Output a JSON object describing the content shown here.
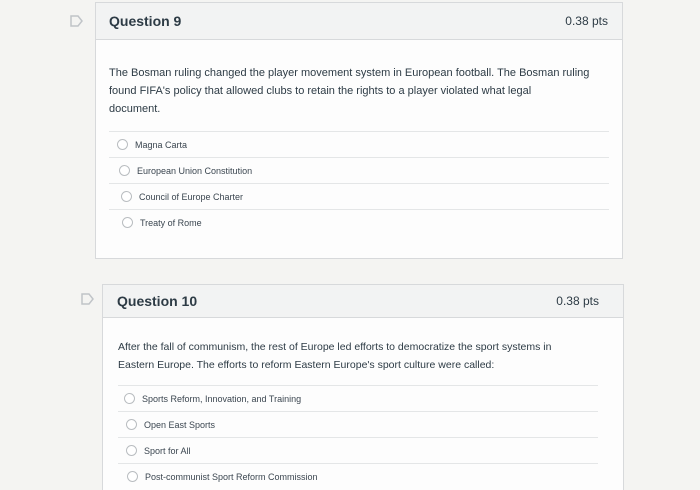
{
  "questions": [
    {
      "title": "Question 9",
      "points": "0.38 pts",
      "text_lines": [
        "The Bosman ruling changed the player movement system in European football. The Bosman ruling",
        "found FIFA's policy that allowed clubs to retain the rights to a player violated what legal",
        "document."
      ],
      "answers": [
        "Magna Carta",
        "European Union Constitution",
        "Council of Europe Charter",
        "Treaty of Rome"
      ]
    },
    {
      "title": "Question 10",
      "points": "0.38 pts",
      "text_lines": [
        "After the fall of communism, the rest of Europe led efforts to democratize the sport systems in",
        "Eastern Europe. The efforts to reform Eastern Europe's sport culture were called:"
      ],
      "answers": [
        "Sports Reform, Innovation, and Training",
        "Open East Sports",
        "Sport for All",
        "Post-communist Sport Reform Commission"
      ]
    }
  ],
  "icons": {
    "flag": "flag-question-icon"
  },
  "colors": {
    "flag_stroke": "#c8cbce",
    "header_bg": "#f2f3f3",
    "border": "#d7d9db"
  }
}
